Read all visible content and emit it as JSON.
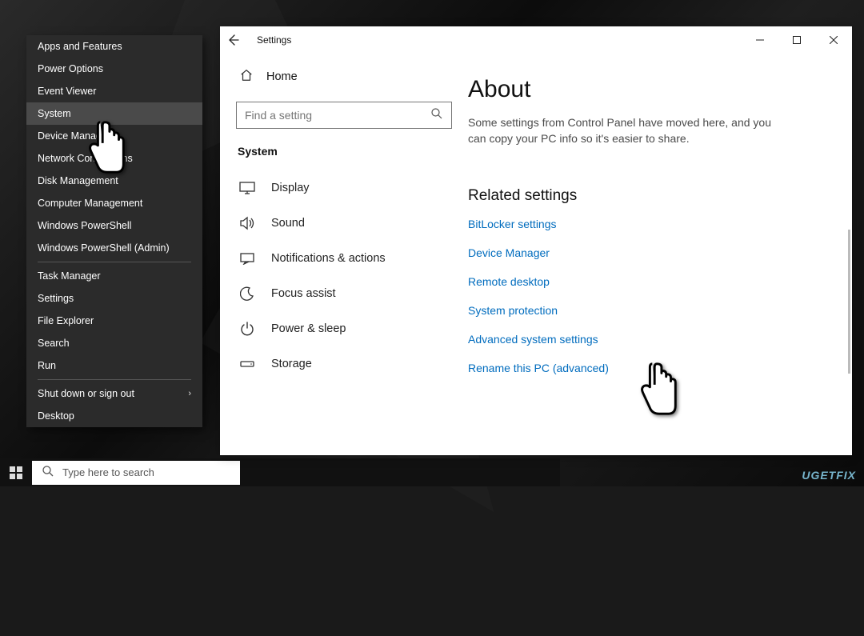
{
  "winx": {
    "items": [
      "Apps and Features",
      "Power Options",
      "Event Viewer",
      "System",
      "Device Manager",
      "Network Connections",
      "Disk Management",
      "Computer Management",
      "Windows PowerShell",
      "Windows PowerShell (Admin)"
    ],
    "items2": [
      "Task Manager",
      "Settings",
      "File Explorer",
      "Search",
      "Run"
    ],
    "items3": [
      "Shut down or sign out",
      "Desktop"
    ],
    "selected": "System"
  },
  "taskbar": {
    "search_placeholder": "Type here to search"
  },
  "settings": {
    "title": "Settings",
    "home": "Home",
    "search_placeholder": "Find a setting",
    "section_title": "System",
    "nav": [
      {
        "icon": "display",
        "label": "Display"
      },
      {
        "icon": "sound",
        "label": "Sound"
      },
      {
        "icon": "notifications",
        "label": "Notifications & actions"
      },
      {
        "icon": "focus",
        "label": "Focus assist"
      },
      {
        "icon": "power",
        "label": "Power & sleep"
      },
      {
        "icon": "storage",
        "label": "Storage"
      }
    ],
    "page": {
      "heading": "About",
      "description": "Some settings from Control Panel have moved here, and you can copy your PC info so it's easier to share.",
      "related_heading": "Related settings",
      "links": [
        "BitLocker settings",
        "Device Manager",
        "Remote desktop",
        "System protection",
        "Advanced system settings",
        "Rename this PC (advanced)"
      ]
    }
  },
  "watermark": "UGETFIX"
}
